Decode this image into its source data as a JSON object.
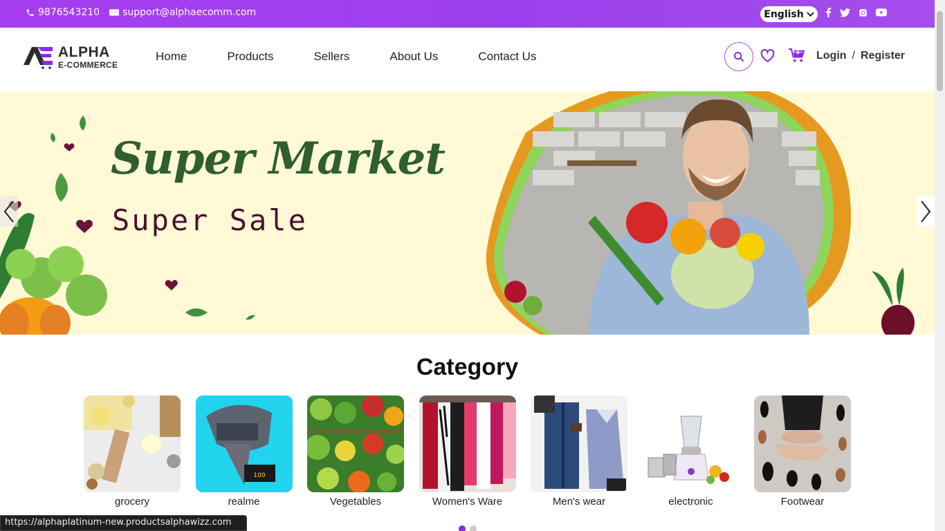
{
  "topbar": {
    "phone": "9876543210",
    "email": "support@alphaecomm.com",
    "language": "English",
    "social_icons": [
      "facebook-icon",
      "twitter-icon",
      "instagram-icon",
      "youtube-icon"
    ],
    "bg_color": "#a63ef0"
  },
  "header": {
    "logo_line1": "ALPHA",
    "logo_line2": "E-COMMERCE",
    "nav": [
      {
        "label": "Home"
      },
      {
        "label": "Products"
      },
      {
        "label": "Sellers"
      },
      {
        "label": "About Us"
      },
      {
        "label": "Contact Us"
      }
    ],
    "login": "Login",
    "separator": "/",
    "register": "Register",
    "accent_color": "#8a2be2"
  },
  "hero": {
    "title": "Super Market",
    "subtitle": "Super Sale",
    "bg_color": "#fff9d6"
  },
  "category": {
    "title": "Category",
    "items": [
      {
        "label": "grocery"
      },
      {
        "label": "realme"
      },
      {
        "label": "Vegetables"
      },
      {
        "label": "Women's Ware"
      },
      {
        "label": "Men's wear"
      },
      {
        "label": "electronic"
      },
      {
        "label": "Footwear"
      }
    ],
    "active_page": 1,
    "page_count": 2
  },
  "statusbar": {
    "url": "https://alphaplatinum-new.productsalphawizz.com"
  }
}
